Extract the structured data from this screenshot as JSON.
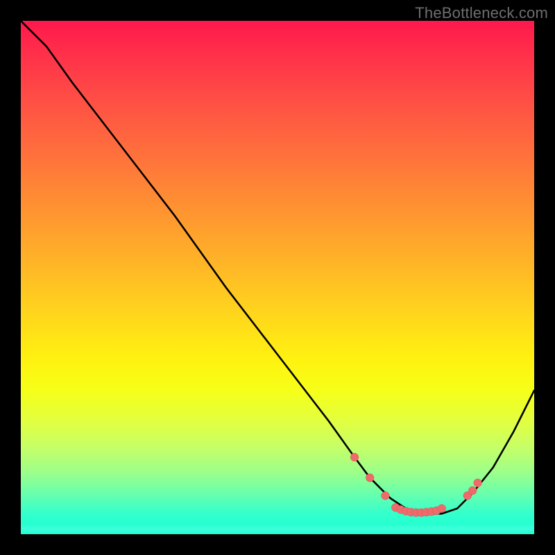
{
  "watermark": "TheBottleneck.com",
  "colors": {
    "background": "#000000",
    "watermark": "#6e6e6e",
    "gradient_stops": [
      "#ff184c",
      "#ff2e4a",
      "#ff4a46",
      "#ff6a3e",
      "#ff8a34",
      "#ffaa2a",
      "#ffd21e",
      "#fff210",
      "#f6ff18",
      "#e2ff40",
      "#c6ff66",
      "#9cff8a",
      "#6affac",
      "#34ffcc",
      "#18ffd6"
    ],
    "curve": "#000000",
    "dot": "#ef6a6a"
  },
  "chart_data": {
    "type": "line",
    "title": "",
    "xlabel": "",
    "ylabel": "",
    "xlim": [
      0,
      100
    ],
    "ylim": [
      0,
      100
    ],
    "note": "Axes are unlabeled; values are normalized 0-100 estimates from pixel positions.",
    "series": [
      {
        "name": "curve",
        "x": [
          0,
          3,
          5,
          10,
          20,
          30,
          40,
          50,
          60,
          65,
          68,
          70,
          72,
          75,
          78,
          80,
          82,
          85,
          88,
          92,
          96,
          100
        ],
        "y": [
          100,
          97,
          95,
          88,
          75,
          62,
          48,
          35,
          22,
          15,
          11,
          9,
          7,
          5,
          4,
          4,
          4,
          5,
          8,
          13,
          20,
          28
        ]
      }
    ],
    "points": {
      "name": "dots",
      "x": [
        65,
        68,
        71,
        73,
        74,
        75,
        76,
        77,
        78,
        79,
        80,
        81,
        82,
        87,
        88,
        89
      ],
      "y": [
        15,
        11,
        7.5,
        5.2,
        4.8,
        4.5,
        4.3,
        4.2,
        4.2,
        4.3,
        4.4,
        4.6,
        5,
        7.5,
        8.5,
        10
      ]
    }
  }
}
